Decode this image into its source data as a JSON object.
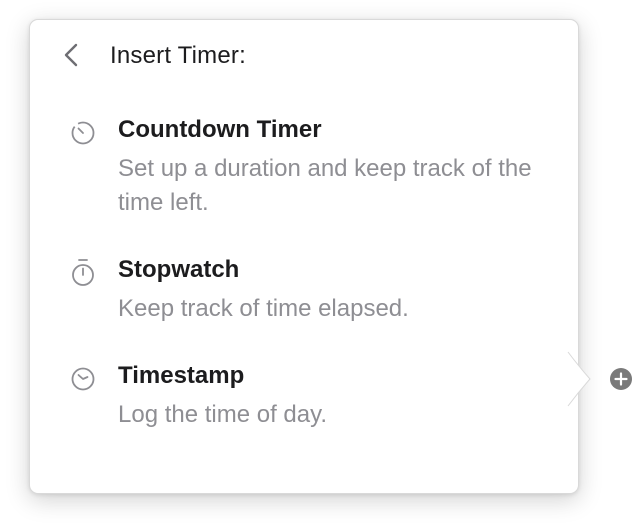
{
  "popover": {
    "title": "Insert Timer:",
    "items": [
      {
        "title": "Countdown Timer",
        "description": "Set up a duration and keep track of the time left.",
        "icon": "countdown-timer-icon"
      },
      {
        "title": "Stopwatch",
        "description": "Keep track of time elapsed.",
        "icon": "stopwatch-icon"
      },
      {
        "title": "Timestamp",
        "description": "Log the time of day.",
        "icon": "clock-icon"
      }
    ]
  },
  "colors": {
    "title_text": "#1c1c1e",
    "description_text": "#8e8e93",
    "icon_gray": "#8e8e93",
    "add_button": "#7a7a7a"
  }
}
